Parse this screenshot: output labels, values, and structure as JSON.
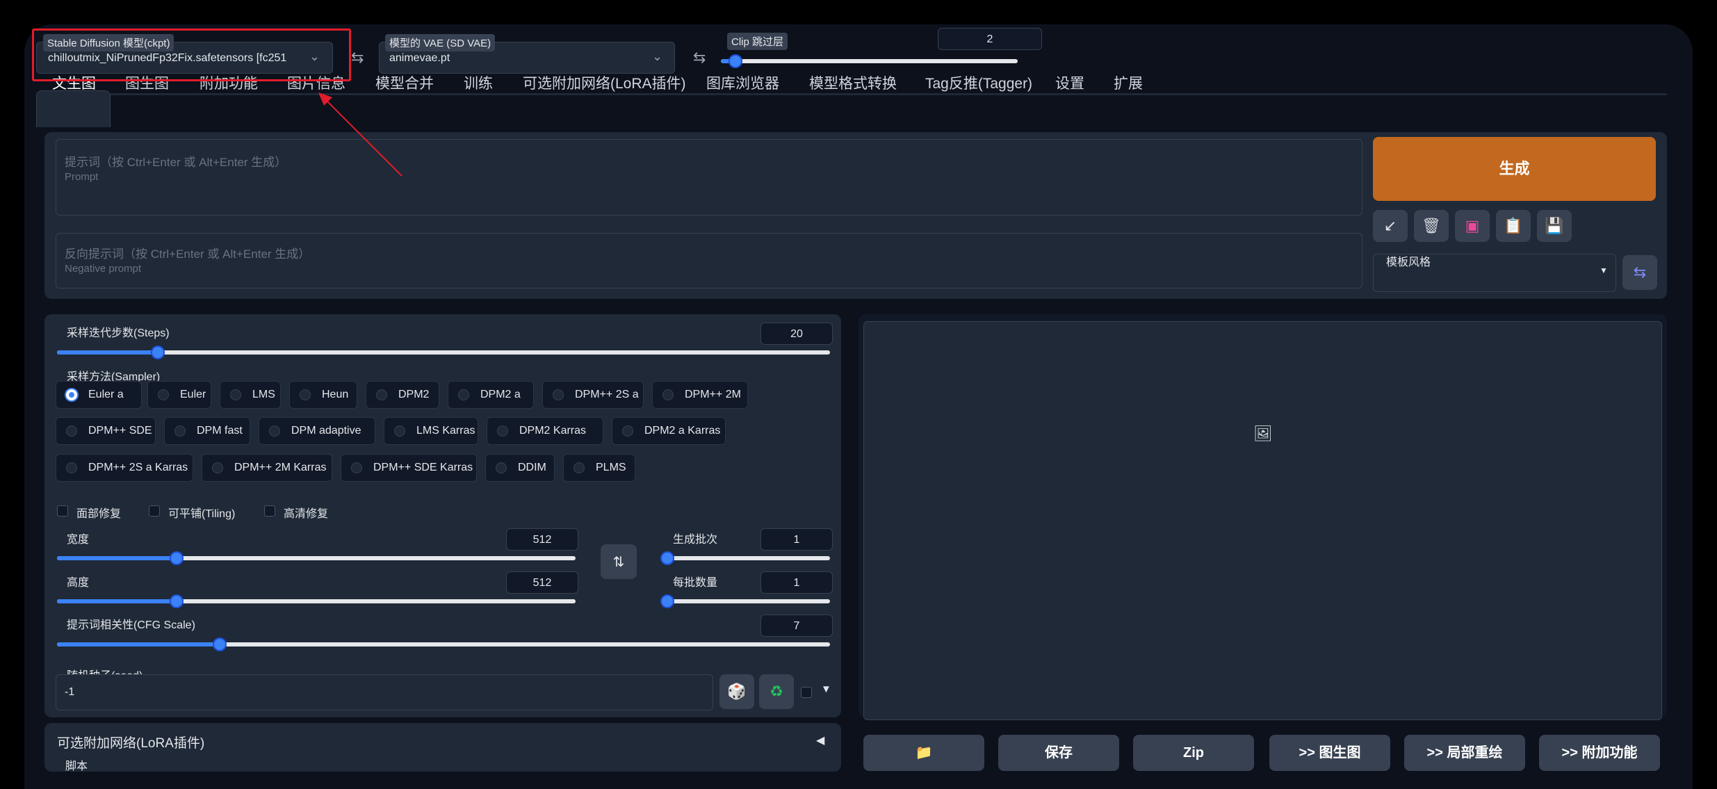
{
  "top": {
    "ckpt": {
      "label": "Stable Diffusion 模型(ckpt)",
      "value": "chilloutmix_NiPrunedFp32Fix.safetensors [fc251"
    },
    "vae": {
      "label": "模型的 VAE (SD VAE)",
      "value": "animevae.pt"
    },
    "clip": {
      "label": "Clip 跳过层",
      "value": "2",
      "fraction": 0.05
    }
  },
  "tabs": [
    "文生图",
    "图生图",
    "附加功能",
    "图片信息",
    "模型合并",
    "训练",
    "可选附加网络(LoRA插件)",
    "图库浏览器",
    "模型格式转换",
    "Tag反推(Tagger)",
    "设置",
    "扩展"
  ],
  "prompt": {
    "placeholder_zh": "提示词（按 Ctrl+Enter 或 Alt+Enter 生成）",
    "placeholder_en": "Prompt"
  },
  "neg_prompt": {
    "placeholder_zh": "反向提示词（按 Ctrl+Enter 或 Alt+Enter 生成）",
    "placeholder_en": "Negative prompt"
  },
  "generate_label": "生成",
  "tool_icons": [
    "arrow-icon",
    "trash-icon",
    "card-icon",
    "clipboard-icon",
    "save-icon"
  ],
  "style": {
    "label": "模板风格"
  },
  "steps": {
    "label": "采样迭代步数(Steps)",
    "value": "20",
    "fraction": 0.13
  },
  "sampler": {
    "label": "采样方法(Sampler)",
    "selected": "Euler a",
    "options": [
      "Euler a",
      "Euler",
      "LMS",
      "Heun",
      "DPM2",
      "DPM2 a",
      "DPM++ 2S a",
      "DPM++ 2M",
      "DPM++ SDE",
      "DPM fast",
      "DPM adaptive",
      "LMS Karras",
      "DPM2 Karras",
      "DPM2 a Karras",
      "DPM++ 2S a Karras",
      "DPM++ 2M Karras",
      "DPM++ SDE Karras",
      "DDIM",
      "PLMS"
    ]
  },
  "checks": {
    "face": "面部修复",
    "tiling": "可平铺(Tiling)",
    "hires": "高清修复"
  },
  "width": {
    "label": "宽度",
    "value": "512",
    "fraction": 0.23
  },
  "height": {
    "label": "高度",
    "value": "512",
    "fraction": 0.23
  },
  "batch_count": {
    "label": "生成批次",
    "value": "1",
    "fraction": 0
  },
  "batch_size": {
    "label": "每批数量",
    "value": "1",
    "fraction": 0
  },
  "cfg": {
    "label": "提示词相关性(CFG Scale)",
    "value": "7",
    "fraction": 0.21
  },
  "seed": {
    "label": "随机种子(seed)",
    "value": "-1"
  },
  "lora": {
    "label": "可选附加网络(LoRA插件)",
    "script_label": "脚本"
  },
  "bottom_buttons": [
    "📁",
    "保存",
    "Zip",
    ">> 图生图",
    ">> 局部重绘",
    ">> 附加功能"
  ],
  "colors": {
    "accent": "#3b82f6",
    "generate": "#c2681f",
    "panel": "#1f2937",
    "highlight": "#e11d2a"
  }
}
